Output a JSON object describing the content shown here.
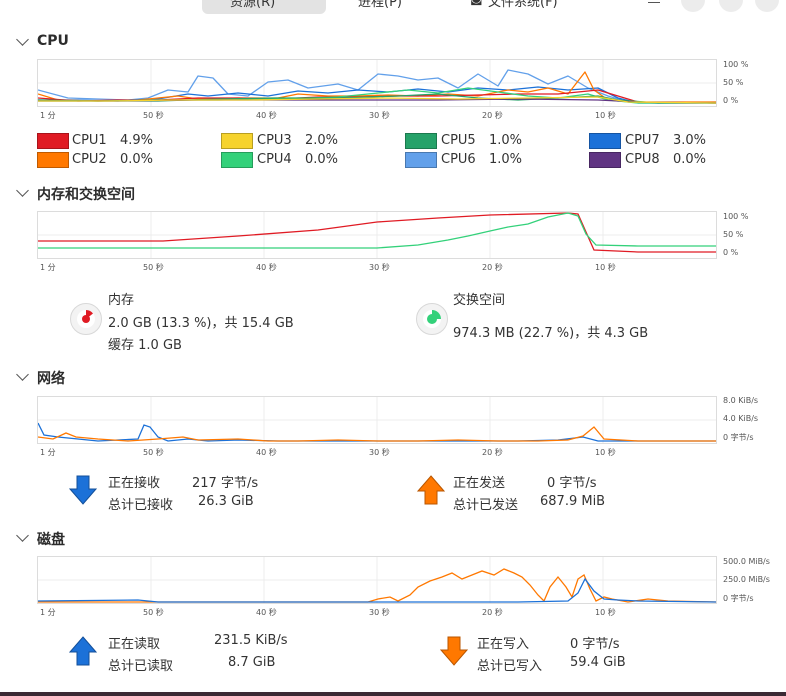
{
  "header": {
    "tabs": [
      {
        "label": "资源(R)",
        "active": true
      },
      {
        "label": "进程(P)",
        "active": false
      },
      {
        "label": "文件系统(F)",
        "active": false
      }
    ]
  },
  "x_ticks": [
    "1 分",
    "50 秒",
    "40 秒",
    "30 秒",
    "20 秒",
    "10 秒"
  ],
  "cpu": {
    "title": "CPU",
    "y_ticks": [
      "100 %",
      "50 %",
      "0 %"
    ],
    "legend": [
      {
        "name": "CPU1",
        "value": "4.9%",
        "color": "#e01b24"
      },
      {
        "name": "CPU2",
        "value": "0.0%",
        "color": "#ff7800"
      },
      {
        "name": "CPU3",
        "value": "2.0%",
        "color": "#f6d32d"
      },
      {
        "name": "CPU4",
        "value": "0.0%",
        "color": "#33d17a"
      },
      {
        "name": "CPU5",
        "value": "1.0%",
        "color": "#26a269"
      },
      {
        "name": "CPU6",
        "value": "1.0%",
        "color": "#62a0ea"
      },
      {
        "name": "CPU7",
        "value": "3.0%",
        "color": "#1c71d8"
      },
      {
        "name": "CPU8",
        "value": "0.0%",
        "color": "#613583"
      }
    ]
  },
  "memory": {
    "title": "内存和交换空间",
    "y_ticks": [
      "100 %",
      "50 %",
      "0 %"
    ],
    "mem": {
      "label": "内存",
      "detail": "2.0 GB (13.3 %)，共 15.4 GB",
      "cache": "缓存 1.0 GB",
      "fraction": 0.133,
      "color": "#e01b24"
    },
    "swap": {
      "label": "交换空间",
      "detail": "974.3 MB (22.7 %)，共 4.3 GB",
      "fraction": 0.227,
      "color": "#33d17a"
    }
  },
  "network": {
    "title": "网络",
    "y_ticks": [
      "8.0 KiB/s",
      "4.0 KiB/s",
      "0 字节/s"
    ],
    "recv_label": "正在接收",
    "recv_value": "217 字节/s",
    "total_recv_label": "总计已接收",
    "total_recv_value": "26.3 GiB",
    "send_label": "正在发送",
    "send_value": "0 字节/s",
    "total_send_label": "总计已发送",
    "total_send_value": "687.9 MiB"
  },
  "disk": {
    "title": "磁盘",
    "y_ticks": [
      "500.0 MiB/s",
      "250.0 MiB/s",
      "0 字节/s"
    ],
    "read_label": "正在读取",
    "read_value": "231.5 KiB/s",
    "total_read_label": "总计已读取",
    "total_read_value": "8.7 GiB",
    "write_label": "正在写入",
    "write_value": "0 字节/s",
    "total_write_label": "总计已写入",
    "total_write_value": "59.4 GiB"
  }
}
